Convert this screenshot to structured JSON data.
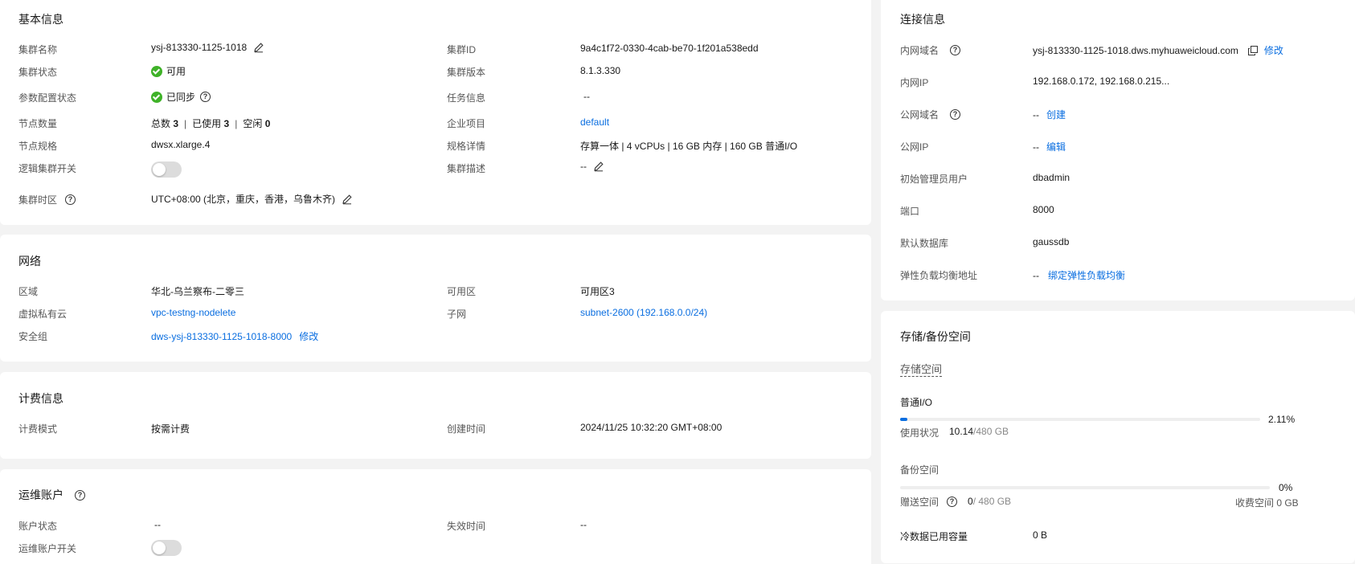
{
  "basic": {
    "title": "基本信息",
    "cluster_name_label": "集群名称",
    "cluster_name": "ysj-813330-1125-1018",
    "cluster_status_label": "集群状态",
    "cluster_status": "可用",
    "param_status_label": "参数配置状态",
    "param_status": "已同步",
    "node_count_label": "节点数量",
    "node_total_label": "总数",
    "node_total": "3",
    "node_used_label": "已使用",
    "node_used": "3",
    "node_idle_label": "空闲",
    "node_idle": "0",
    "node_spec_label": "节点规格",
    "node_spec": "dwsx.xlarge.4",
    "logic_cluster_label": "逻辑集群开关",
    "timezone_label": "集群时区",
    "timezone": "UTC+08:00 (北京，重庆，香港，乌鲁木齐)",
    "cluster_id_label": "集群ID",
    "cluster_id": "9a4c1f72-0330-4cab-be70-1f201a538edd",
    "version_label": "集群版本",
    "version": "8.1.3.330",
    "task_label": "任务信息",
    "task": "--",
    "enterprise_label": "企业项目",
    "enterprise": "default",
    "spec_detail_label": "规格详情",
    "spec_detail": "存算一体 | 4 vCPUs | 16 GB 内存 | 160 GB 普通I/O",
    "desc_label": "集群描述",
    "desc": "--"
  },
  "network": {
    "title": "网络",
    "region_label": "区域",
    "region": "华北-乌兰察布-二零三",
    "vpc_label": "虚拟私有云",
    "vpc": "vpc-testng-nodelete",
    "sg_label": "安全组",
    "sg": "dws-ysj-813330-1125-1018-8000",
    "sg_modify": "修改",
    "az_label": "可用区",
    "az": "可用区3",
    "subnet_label": "子网",
    "subnet": "subnet-2600 (192.168.0.0/24)"
  },
  "billing": {
    "title": "计费信息",
    "mode_label": "计费模式",
    "mode": "按需计费",
    "created_label": "创建时间",
    "created": "2024/11/25 10:32:20 GMT+08:00"
  },
  "ops": {
    "title": "运维账户",
    "status_label": "账户状态",
    "status": "--",
    "switch_label": "运维账户开关",
    "expire_label": "失效时间",
    "expire": "--"
  },
  "connection": {
    "title": "连接信息",
    "private_domain_label": "内网域名",
    "private_domain": "ysj-813330-1125-1018.dws.myhuaweicloud.com",
    "private_domain_modify": "修改",
    "private_ip_label": "内网IP",
    "private_ip": "192.168.0.172, 192.168.0.215...",
    "public_domain_label": "公网域名",
    "public_domain": "--",
    "public_domain_create": "创建",
    "public_ip_label": "公网IP",
    "public_ip": "--",
    "public_ip_edit": "编辑",
    "admin_label": "初始管理员用户",
    "admin": "dbadmin",
    "port_label": "端口",
    "port": "8000",
    "db_label": "默认数据库",
    "db": "gaussdb",
    "elb_label": "弹性负载均衡地址",
    "elb": "--",
    "elb_bind": "绑定弹性负载均衡"
  },
  "storage": {
    "title": "存储/备份空间",
    "storage_label": "存储空间",
    "io_label": "普通I/O",
    "io_percent": "2.11%",
    "io_fraction": 0.0211,
    "usage_label": "使用状况",
    "usage_used": "10.14",
    "usage_total": " /480 GB",
    "backup_label": "备份空间",
    "backup_percent": "0%",
    "backup_fraction": 0,
    "gift_label": "赠送空间",
    "gift_used": "0",
    "gift_total": " / 480 GB",
    "charged_label": "收费空间 0 GB",
    "cold_label": "冷数据已用容量",
    "cold": "0 B"
  }
}
